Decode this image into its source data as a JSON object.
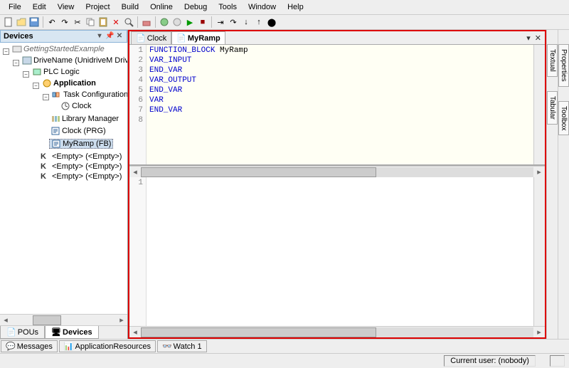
{
  "menu": [
    "File",
    "Edit",
    "View",
    "Project",
    "Build",
    "Online",
    "Debug",
    "Tools",
    "Window",
    "Help"
  ],
  "devices_panel": {
    "title": "Devices"
  },
  "tree": {
    "root": "GettingStartedExample",
    "drive": "DriveName (UnidriveM Drive)",
    "plc": "PLC Logic",
    "app": "Application",
    "task": "Task Configuration",
    "clock_task": "Clock",
    "lib": "Library Manager",
    "clock_prg": "Clock (PRG)",
    "myramp": "MyRamp (FB)",
    "empty1": "<Empty> (<Empty>)",
    "empty2": "<Empty> (<Empty>)",
    "empty3": "<Empty> (<Empty>)"
  },
  "left_tabs": {
    "pous": "POUs",
    "devices": "Devices"
  },
  "editor_tabs": {
    "clock": "Clock",
    "myramp": "MyRamp"
  },
  "code_lines": [
    {
      "n": "1",
      "parts": [
        {
          "t": "FUNCTION_BLOCK",
          "c": "kw"
        },
        {
          "t": " ",
          "c": ""
        },
        {
          "t": "MyRamp",
          "c": "nm"
        }
      ]
    },
    {
      "n": "2",
      "parts": [
        {
          "t": "VAR_INPUT",
          "c": "kw"
        }
      ]
    },
    {
      "n": "3",
      "parts": [
        {
          "t": "END_VAR",
          "c": "kw"
        }
      ]
    },
    {
      "n": "4",
      "parts": [
        {
          "t": "VAR_OUTPUT",
          "c": "kw"
        }
      ]
    },
    {
      "n": "5",
      "parts": [
        {
          "t": "END_VAR",
          "c": "kw"
        }
      ]
    },
    {
      "n": "6",
      "parts": [
        {
          "t": "VAR",
          "c": "kw"
        }
      ]
    },
    {
      "n": "7",
      "parts": [
        {
          "t": "END_VAR",
          "c": "kw"
        }
      ]
    },
    {
      "n": "8",
      "parts": []
    }
  ],
  "side_tabs": {
    "textual": "Textual",
    "tabular": "Tabular",
    "properties": "Properties",
    "toolbox": "Toolbox"
  },
  "footer_tabs": {
    "messages": "Messages",
    "appres": "ApplicationResources",
    "watch": "Watch 1"
  },
  "status": {
    "user": "Current user: (nobody)"
  }
}
